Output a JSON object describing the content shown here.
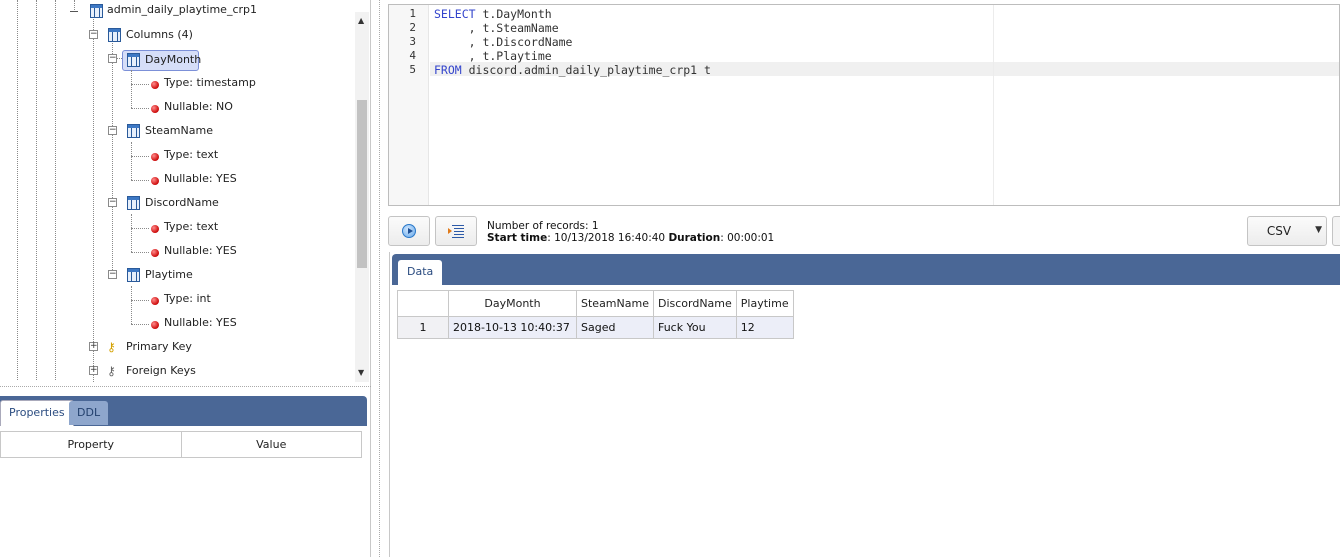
{
  "tree": {
    "table_name": "admin_daily_playtime_crp1",
    "columns_folder": "Columns (4)",
    "columns": [
      {
        "name": "DayMonth",
        "type": "Type: timestamp",
        "nullable": "Nullable: NO",
        "selected": true
      },
      {
        "name": "SteamName",
        "type": "Type: text",
        "nullable": "Nullable: YES"
      },
      {
        "name": "DiscordName",
        "type": "Type: text",
        "nullable": "Nullable: YES"
      },
      {
        "name": "Playtime",
        "type": "Type: int",
        "nullable": "Nullable: YES"
      }
    ],
    "primary_key": "Primary Key",
    "foreign_keys": "Foreign Keys"
  },
  "properties": {
    "tabs": [
      "Properties",
      "DDL"
    ],
    "headers": [
      "Property",
      "Value"
    ]
  },
  "editor": {
    "line_numbers": [
      "1",
      "2",
      "3",
      "4",
      "5"
    ],
    "lines": [
      {
        "kw": "SELECT",
        "text": " t.DayMonth"
      },
      {
        "kw": "",
        "text": "     , t.SteamName"
      },
      {
        "kw": "",
        "text": "     , t.DiscordName"
      },
      {
        "kw": "",
        "text": "     , t.Playtime"
      },
      {
        "kw": "FROM",
        "text": " discord.admin_daily_playtime_crp1 t"
      }
    ]
  },
  "stats": {
    "records_label": "Number of records: 1",
    "start_label": "Start time",
    "start_value": ": 10/13/2018 16:40:40 ",
    "duration_label": "Duration",
    "duration_value": ": 00:00:01"
  },
  "export": {
    "format": "CSV"
  },
  "results": {
    "tab": "Data",
    "headers": [
      "",
      "DayMonth",
      "SteamName",
      "DiscordName",
      "Playtime"
    ],
    "rows": [
      [
        "1",
        "2018-10-13 10:40:37",
        "Saged",
        "Fuck You",
        "12"
      ]
    ]
  },
  "colors": {
    "tab_bar": "#4a6796",
    "keyword": "#3344cc",
    "selected_bg": "#d6def8"
  }
}
